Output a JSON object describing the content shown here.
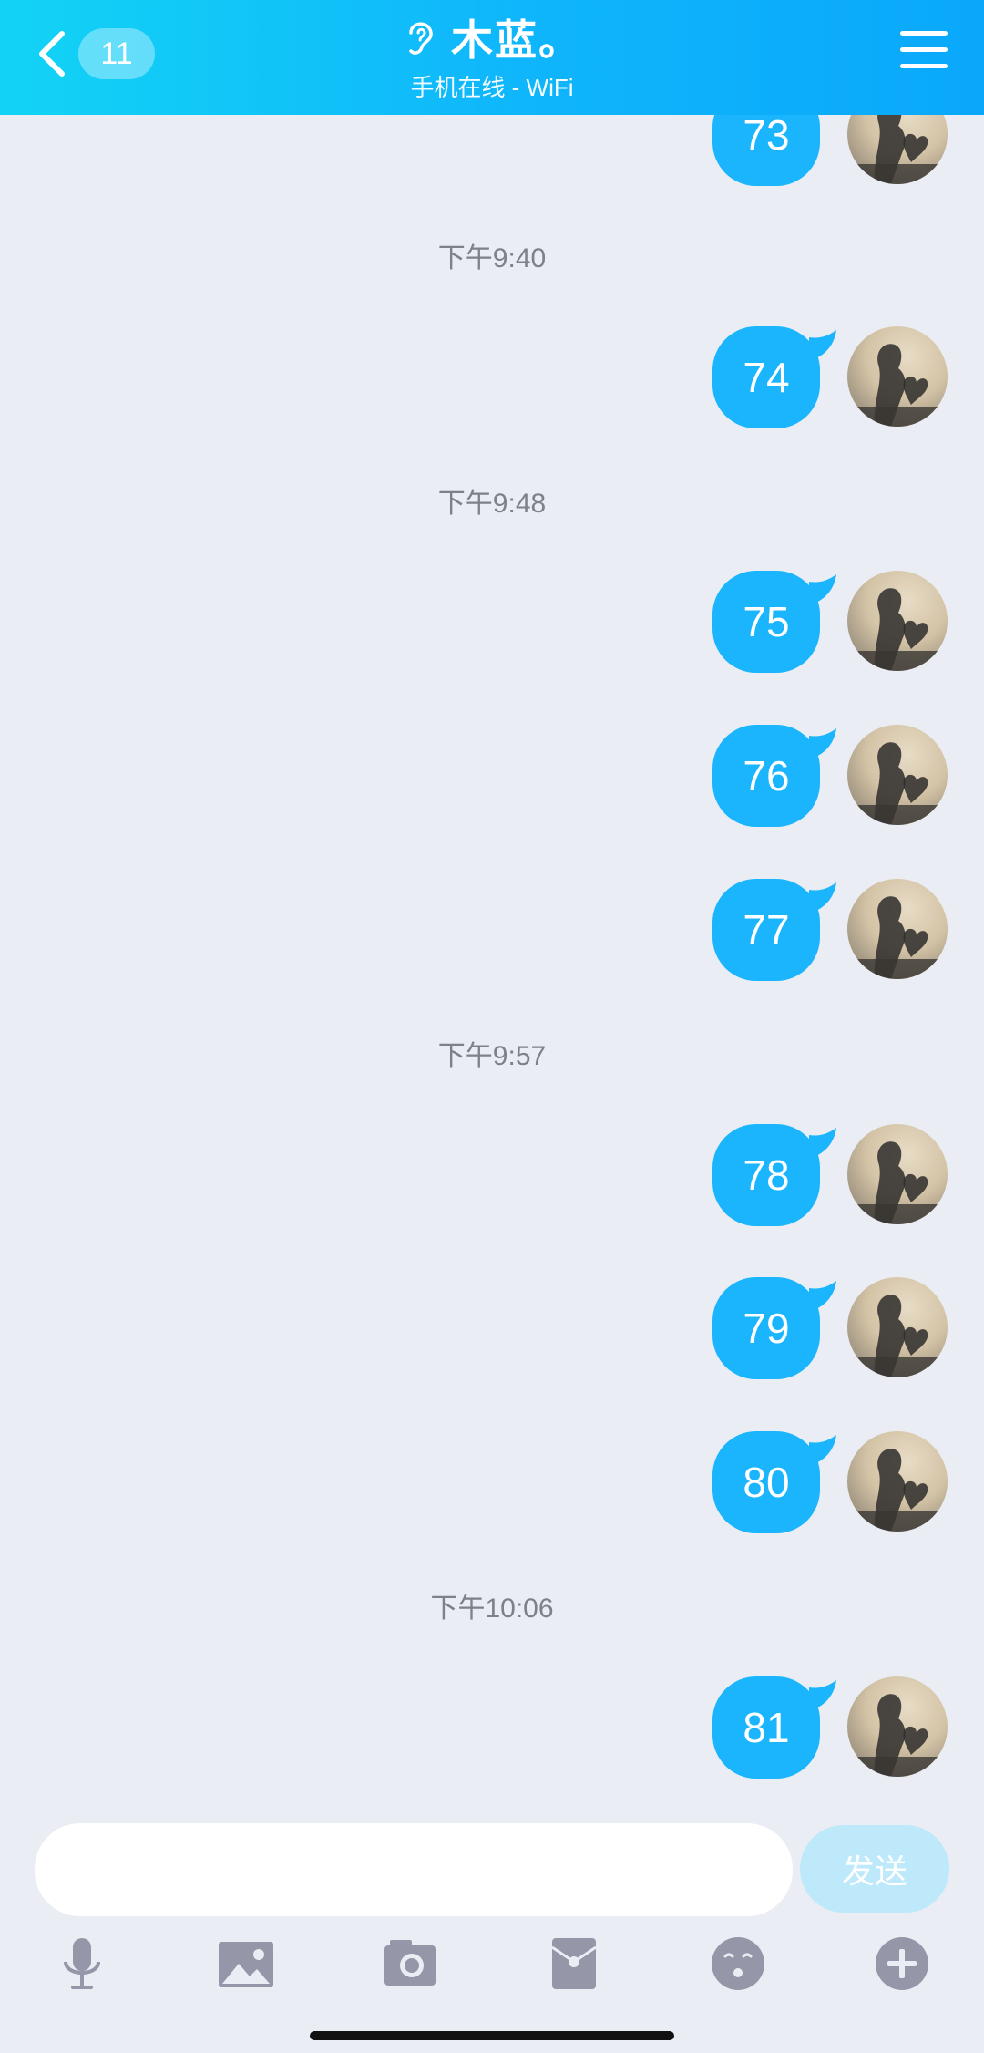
{
  "header": {
    "back_count": "11",
    "title": "木蓝。",
    "status": "手机在线 - WiFi"
  },
  "messages": [
    {
      "kind": "msg",
      "text": "73"
    },
    {
      "kind": "time",
      "text": "下午9:40"
    },
    {
      "kind": "msg",
      "text": "74"
    },
    {
      "kind": "time",
      "text": "下午9:48"
    },
    {
      "kind": "msg",
      "text": "75"
    },
    {
      "kind": "msg",
      "text": "76"
    },
    {
      "kind": "msg",
      "text": "77"
    },
    {
      "kind": "time",
      "text": "下午9:57"
    },
    {
      "kind": "msg",
      "text": "78"
    },
    {
      "kind": "msg",
      "text": "79"
    },
    {
      "kind": "msg",
      "text": "80"
    },
    {
      "kind": "time",
      "text": "下午10:06"
    },
    {
      "kind": "msg",
      "text": "81"
    }
  ],
  "input": {
    "value": "",
    "placeholder": "",
    "send_label": "发送"
  },
  "toolbar": [
    "microphone-icon",
    "image-icon",
    "camera-icon",
    "red-packet-icon",
    "emoji-icon",
    "plus-icon"
  ],
  "colors": {
    "header_start": "#12d3f5",
    "header_end": "#0aa8fb",
    "bubble": "#1bb5fd",
    "background": "#eaedf4",
    "send_disabled": "#bde9fb",
    "toolbar_icon": "#9597a8"
  }
}
